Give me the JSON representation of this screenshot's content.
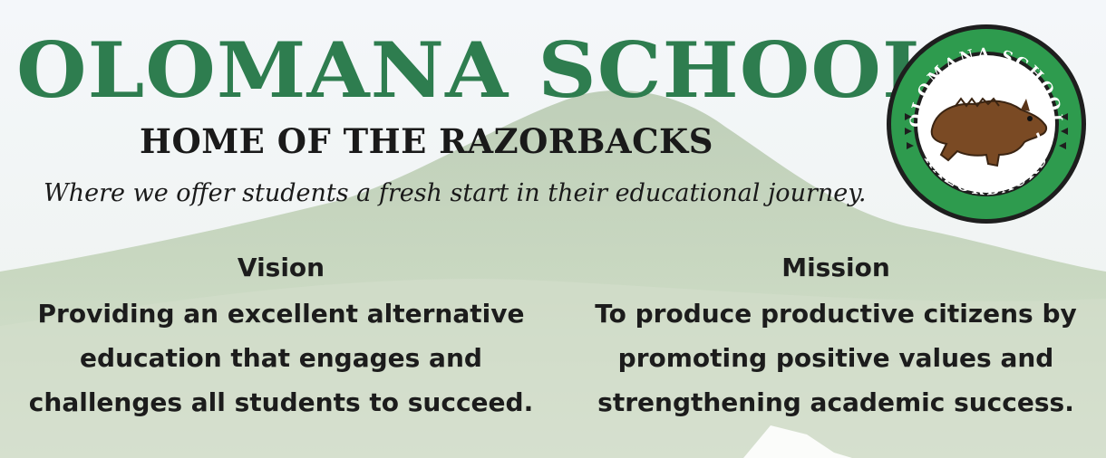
{
  "header": {
    "title": "OLOMANA SCHOOL",
    "subtitle": "HOME OF THE RAZORBACKS",
    "tagline": "Where we offer students a fresh start in their educational journey."
  },
  "logo": {
    "top_text": "OLOMANA SCHOOL",
    "bottom_text": "RAZORBACKS",
    "icon": "razorback-boar-icon"
  },
  "vision": {
    "heading": "Vision",
    "body": "Providing an excellent alternative education that engages and challenges all students to succeed."
  },
  "mission": {
    "heading": "Mission",
    "body": "To produce productive citizens by promoting positive values and strengthening academic success."
  },
  "colors": {
    "brand_green": "#2e7d4f",
    "text_dark": "#1c1c1c",
    "logo_ring": "#2e9b4e"
  }
}
